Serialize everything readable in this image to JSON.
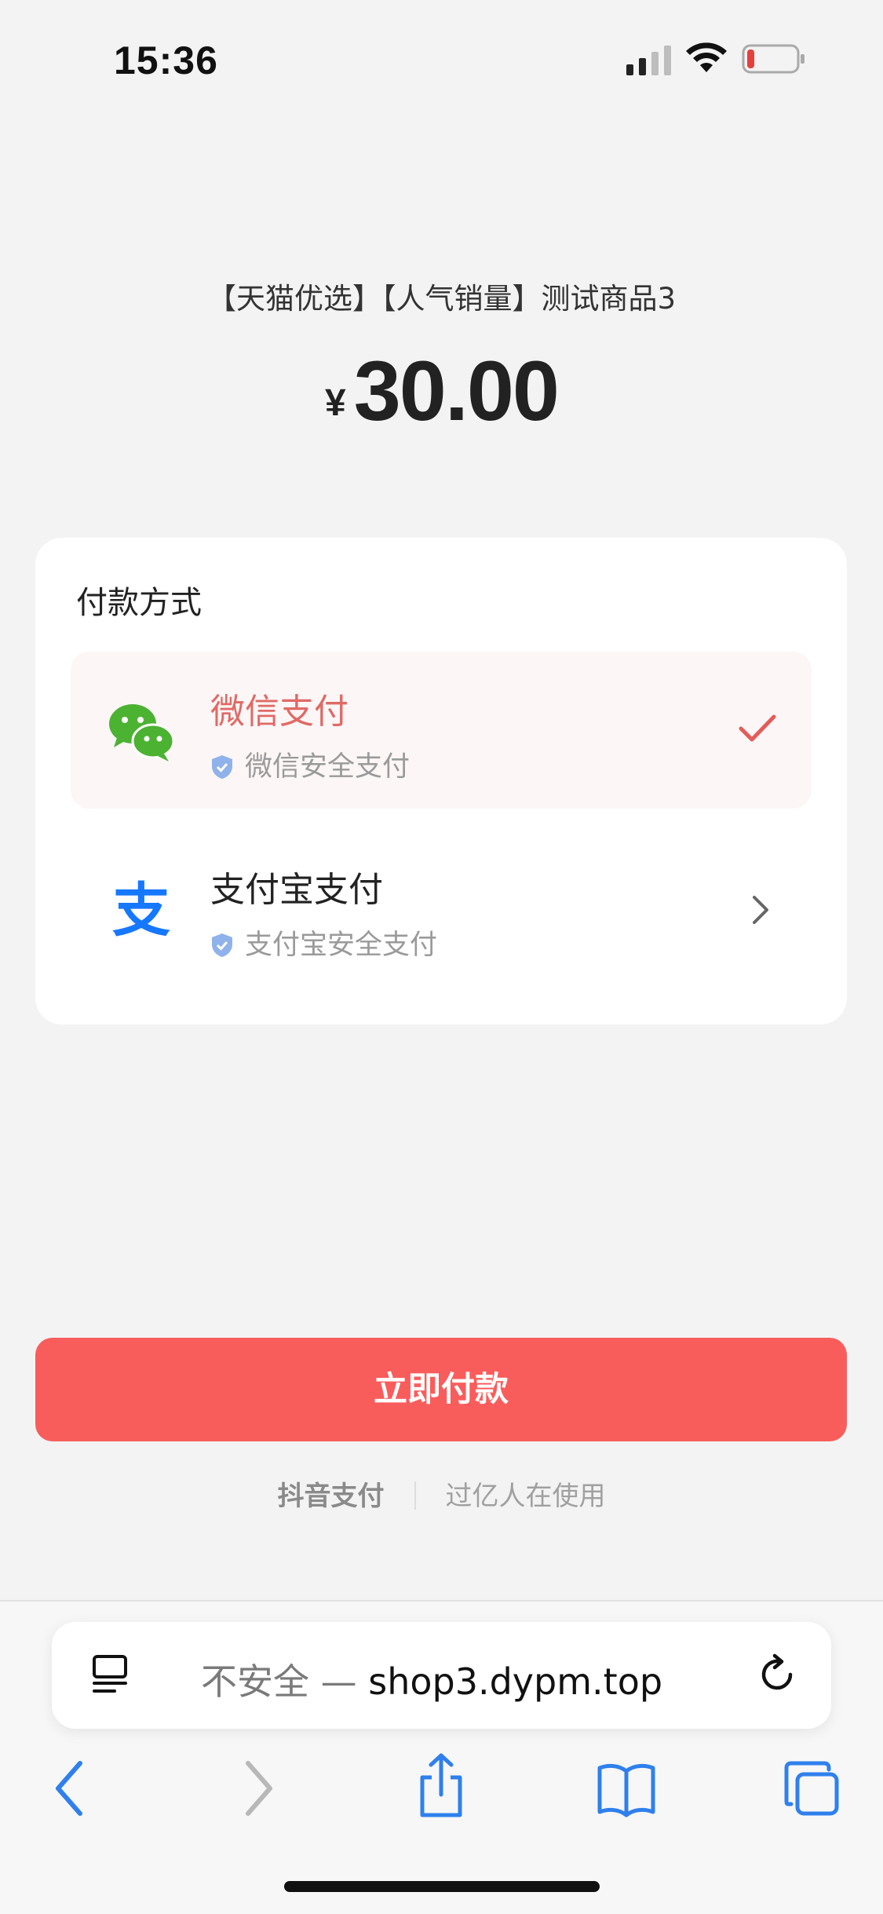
{
  "status_bar": {
    "time": "15:36"
  },
  "product": {
    "title": "【天猫优选】【人气销量】测试商品3",
    "currency_symbol": "¥",
    "price": "30.00"
  },
  "payment": {
    "section_title": "付款方式",
    "options": [
      {
        "label": "微信支付",
        "sublabel": "微信安全支付",
        "icon": "wechat-icon",
        "selected": true
      },
      {
        "label": "支付宝支付",
        "sublabel": "支付宝安全支付",
        "icon": "alipay-icon",
        "selected": false
      }
    ],
    "pay_button_label": "立即付款",
    "footer_brand": "抖音支付",
    "footer_slogan": "过亿人在使用"
  },
  "browser": {
    "address_prefix": "不安全 — ",
    "address_host": "shop3.dypm.top"
  },
  "colors": {
    "accent": "#f95d5b",
    "selected_label": "#e06a66",
    "wechat_green": "#4cb232",
    "alipay_blue": "#1677ff",
    "safari_blue": "#2f80ed"
  }
}
